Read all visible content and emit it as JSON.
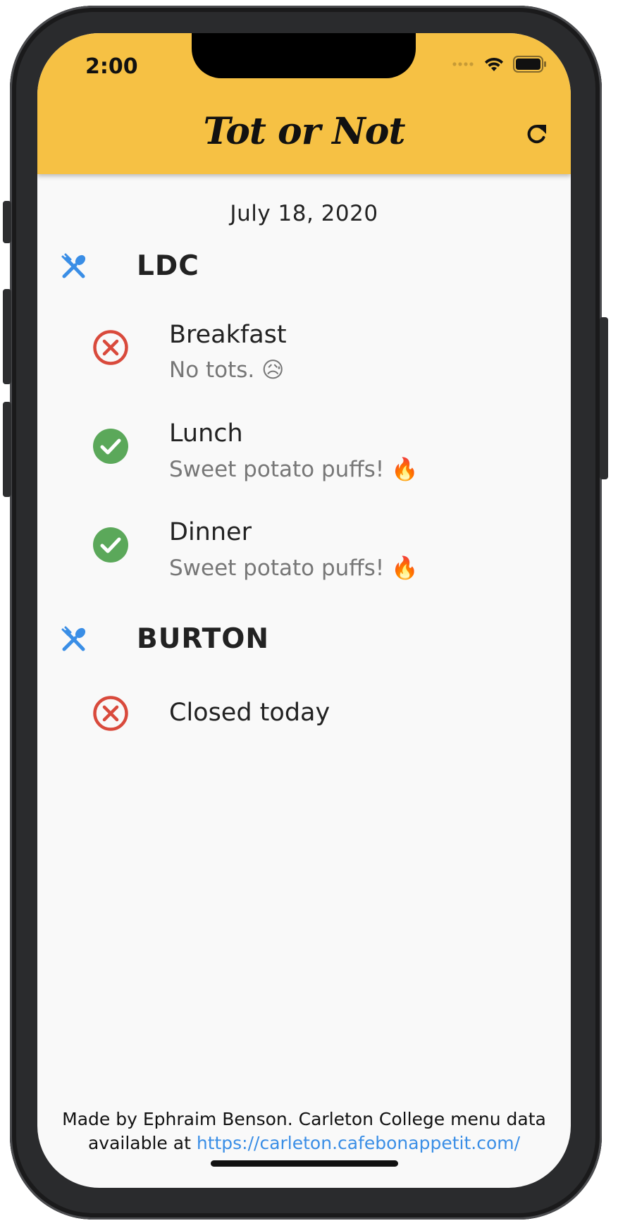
{
  "status_bar": {
    "time": "2:00"
  },
  "appbar": {
    "title": "Tot or Not",
    "refresh_icon": "refresh-icon"
  },
  "date": "July 18, 2020",
  "halls": [
    {
      "name": "LDC",
      "icon": "utensils-icon",
      "meals": [
        {
          "name": "Breakfast",
          "description": "No tots. 😥",
          "status": "no"
        },
        {
          "name": "Lunch",
          "description": "Sweet potato puffs! 🔥",
          "status": "yes"
        },
        {
          "name": "Dinner",
          "description": "Sweet potato puffs! 🔥",
          "status": "yes"
        }
      ]
    },
    {
      "name": "BURTON",
      "icon": "utensils-icon",
      "meals": [
        {
          "name": "Closed today",
          "description": "",
          "status": "no"
        }
      ]
    }
  ],
  "footer": {
    "text": "Made by Ephraim Benson. Carleton College menu data available at",
    "link": "https://carleton.cafebonappetit.com/"
  },
  "colors": {
    "appbar": "#f6c144",
    "yes": "#5ba85a",
    "no": "#d94a3c",
    "icon": "#3a8ee6",
    "link": "#3a8ee6"
  }
}
